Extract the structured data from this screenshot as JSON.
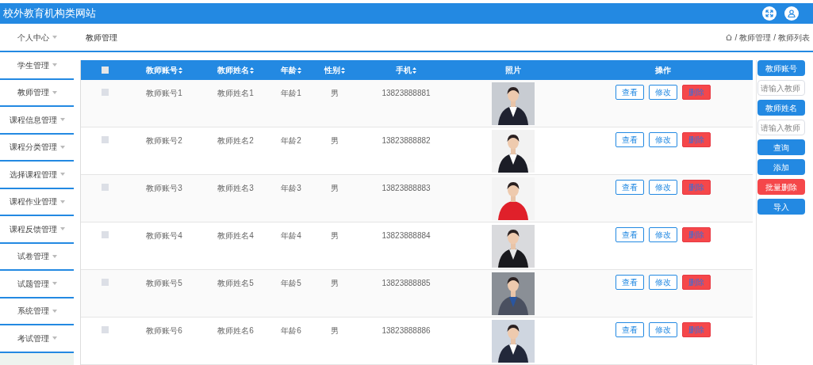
{
  "header": {
    "title": "校外教育机构类网站"
  },
  "breadcrumb": {
    "page_title": "教师管理",
    "path": [
      "教师管理",
      "教师列表"
    ],
    "separator": "/"
  },
  "sidebar": {
    "items": [
      {
        "label": "个人中心"
      },
      {
        "label": "学生管理"
      },
      {
        "label": "教师管理"
      },
      {
        "label": "课程信息管理"
      },
      {
        "label": "课程分类管理"
      },
      {
        "label": "选择课程管理"
      },
      {
        "label": "课程作业管理"
      },
      {
        "label": "课程反馈管理"
      },
      {
        "label": "试卷管理"
      },
      {
        "label": "试题管理"
      },
      {
        "label": "系统管理"
      },
      {
        "label": "考试管理"
      }
    ]
  },
  "table": {
    "header_checkbox": {
      "checked": false
    },
    "columns": [
      {
        "label": "教师账号",
        "sortable": true
      },
      {
        "label": "教师姓名",
        "sortable": true
      },
      {
        "label": "年龄",
        "sortable": true
      },
      {
        "label": "性别",
        "sortable": true
      },
      {
        "label": "手机",
        "sortable": true
      },
      {
        "label": "照片",
        "sortable": false
      },
      {
        "label": "操作",
        "sortable": false
      }
    ],
    "rows": [
      {
        "checked": false,
        "cells": [
          "教师账号1",
          "教师姓名1",
          "年龄1",
          "男",
          "13823888881"
        ],
        "photo": {
          "kind": "picture"
        },
        "actions": [
          {
            "label": "查看",
            "kind": "outline"
          },
          {
            "label": "修改",
            "kind": "outline"
          },
          {
            "label": "删除",
            "kind": "danger"
          }
        ]
      },
      {
        "checked": false,
        "cells": [
          "教师账号2",
          "教师姓名2",
          "年龄2",
          "男",
          "13823888882"
        ],
        "photo": {
          "kind": "picture"
        },
        "actions": [
          {
            "label": "查看",
            "kind": "outline"
          },
          {
            "label": "修改",
            "kind": "outline"
          },
          {
            "label": "删除",
            "kind": "danger"
          }
        ]
      },
      {
        "checked": false,
        "cells": [
          "教师账号3",
          "教师姓名3",
          "年龄3",
          "男",
          "13823888883"
        ],
        "photo": {
          "kind": "picture"
        },
        "actions": [
          {
            "label": "查看",
            "kind": "outline"
          },
          {
            "label": "修改",
            "kind": "outline"
          },
          {
            "label": "删除",
            "kind": "danger"
          }
        ]
      },
      {
        "checked": false,
        "cells": [
          "教师账号4",
          "教师姓名4",
          "年龄4",
          "男",
          "13823888884"
        ],
        "photo": {
          "kind": "picture"
        },
        "actions": [
          {
            "label": "查看",
            "kind": "outline"
          },
          {
            "label": "修改",
            "kind": "outline"
          },
          {
            "label": "删除",
            "kind": "danger"
          }
        ]
      },
      {
        "checked": false,
        "cells": [
          "教师账号5",
          "教师姓名5",
          "年龄5",
          "男",
          "13823888885"
        ],
        "photo": {
          "kind": "picture"
        },
        "actions": [
          {
            "label": "查看",
            "kind": "outline"
          },
          {
            "label": "修改",
            "kind": "outline"
          },
          {
            "label": "删除",
            "kind": "danger"
          }
        ]
      },
      {
        "checked": false,
        "cells": [
          "教师账号6",
          "教师姓名6",
          "年龄6",
          "男",
          "13823888886"
        ],
        "photo": {
          "kind": "picture"
        },
        "actions": [
          {
            "label": "查看",
            "kind": "outline"
          },
          {
            "label": "修改",
            "kind": "outline"
          },
          {
            "label": "删除",
            "kind": "danger"
          }
        ]
      }
    ]
  },
  "search_panel": [
    {
      "kind": "label",
      "text": "教师账号"
    },
    {
      "kind": "input",
      "placeholder": "请输入教师"
    },
    {
      "kind": "label",
      "text": "教师姓名"
    },
    {
      "kind": "input",
      "placeholder": "请输入教师"
    },
    {
      "kind": "button",
      "text": "查询"
    },
    {
      "kind": "button",
      "text": "添加"
    },
    {
      "kind": "danger",
      "text": "批量删除"
    },
    {
      "kind": "button",
      "text": "导入"
    }
  ]
}
